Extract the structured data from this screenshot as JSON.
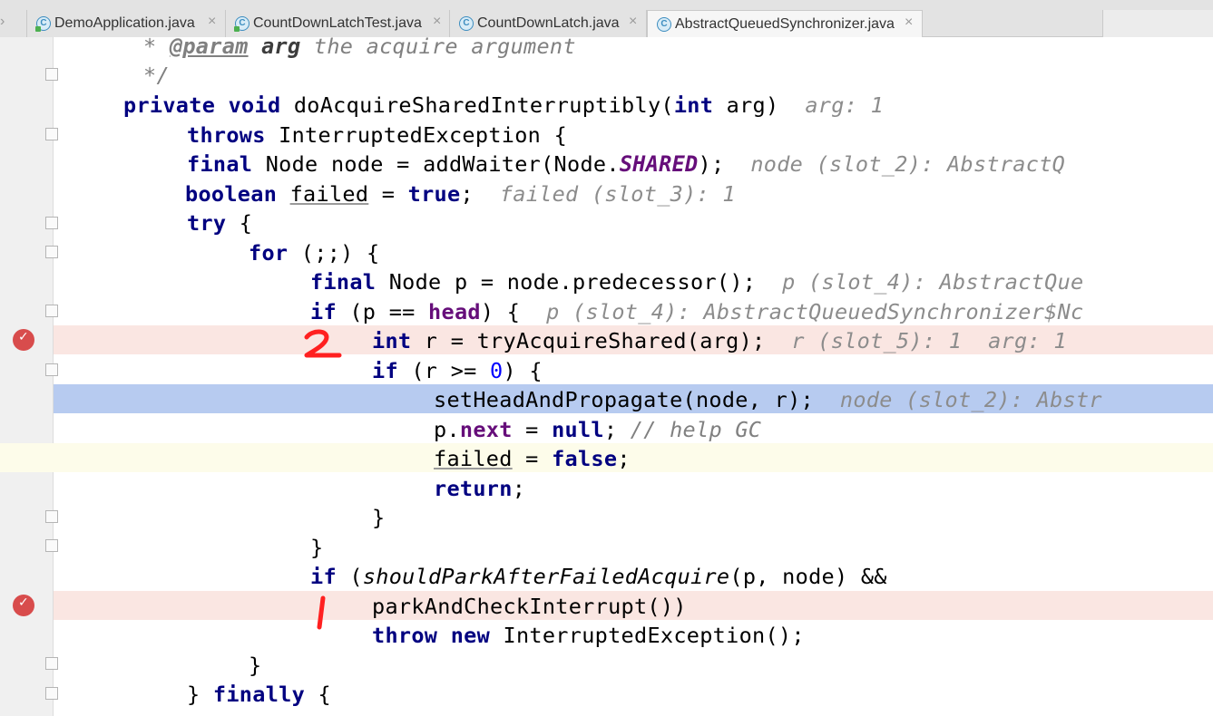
{
  "tabs": [
    {
      "label": "DemoApplication.java",
      "icon": "java-class-icon",
      "close": "×"
    },
    {
      "label": "CountDownLatchTest.java",
      "icon": "java-class-icon",
      "close": "×"
    },
    {
      "label": "CountDownLatch.java",
      "icon": "java-class-icon",
      "close": "×"
    },
    {
      "label": "AbstractQueuedSynchronizer.java",
      "icon": "java-class-icon",
      "close": "×"
    }
  ],
  "editor": {
    "javadoc": {
      "star": "* ",
      "tag": "@param",
      "name": "arg",
      "text": " the acquire argument",
      "end": "*/"
    },
    "method": {
      "kw1": "private",
      "kw2": "void",
      "name": " doAcquireSharedInterruptibly(",
      "kw3": "int",
      "param": " arg)",
      "hint": "arg: 1"
    },
    "throws_line": {
      "kw": "throws",
      "rest": " InterruptedException {"
    },
    "node_line": {
      "kw": "final",
      "rest1": " Node node = addWaiter(Node.",
      "const": "SHARED",
      "rest2": ");",
      "hint": "node (slot_2): AbstractQ"
    },
    "failed_line": {
      "kw": "boolean",
      "var": "failed",
      "eq": " = ",
      "val": "true",
      "semi": ";",
      "hint": "failed (slot_3): 1"
    },
    "try_line": {
      "kw": "try",
      "rest": " {"
    },
    "for_line": {
      "kw": "for",
      "rest": " (;;) {"
    },
    "pred_line": {
      "kw": "final",
      "rest": " Node p = node.predecessor();",
      "hint": "p (slot_4): AbstractQue"
    },
    "if_head_line": {
      "kw": "if",
      "rest1": " (p == ",
      "field": "head",
      "rest2": ") {",
      "hint": "p (slot_4): AbstractQueuedSynchronizer$Nc"
    },
    "int_r_line": {
      "kw": "int",
      "rest": " r = tryAcquireShared(arg);",
      "hint": "r (slot_5): 1  arg: 1"
    },
    "if_r_line": {
      "kw": "if",
      "rest1": " (r >= ",
      "num": "0",
      "rest2": ") {"
    },
    "sethead_line": {
      "code": "setHeadAndPropagate(node, r);",
      "hint": "node (slot_2): Abstr"
    },
    "pnext_line": {
      "pre": "p.",
      "field": "next",
      "mid": " = ",
      "val": "null",
      "semi": ";",
      "comment": " // help GC"
    },
    "failed_false_line": {
      "var": "failed",
      "mid": " = ",
      "val": "false",
      "semi": ";"
    },
    "return_line": {
      "kw": "return",
      "semi": ";"
    },
    "brace_inner": "}",
    "brace_if": "}",
    "should_park_line": {
      "kw": "if",
      "open": " (",
      "method": "shouldParkAfterFailedAcquire",
      "rest": "(p, node) &&"
    },
    "park_line": {
      "code": "parkAndCheckInterrupt())"
    },
    "throw_line": {
      "kw1": "throw",
      "kw2": "new",
      "rest": " InterruptedException();"
    },
    "brace_for": "}",
    "finally_line": {
      "brace": "}",
      "kw": "finally",
      "rest": " {"
    }
  },
  "annotations": {
    "two": "2",
    "one": "1"
  }
}
